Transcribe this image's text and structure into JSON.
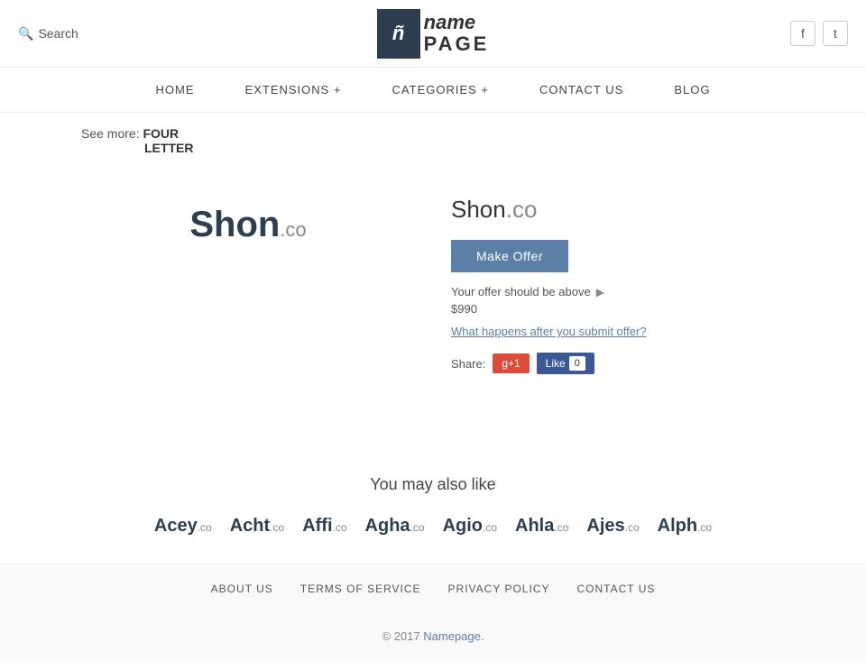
{
  "header": {
    "search_label": "Search",
    "logo_icon": "ñ",
    "logo_name": "name",
    "logo_page": "PAGE",
    "facebook_icon": "f",
    "twitter_icon": "t"
  },
  "nav": {
    "items": [
      {
        "label": "HOME",
        "id": "home"
      },
      {
        "label": "EXTENSIONS +",
        "id": "extensions"
      },
      {
        "label": "CATEGORIES +",
        "id": "categories"
      },
      {
        "label": "CONTACT US",
        "id": "contact"
      },
      {
        "label": "BLOG",
        "id": "blog"
      }
    ]
  },
  "breadcrumb": {
    "prefix": "See more:",
    "link1": "FOUR",
    "link2": "LETTER"
  },
  "domain": {
    "name": "Shon",
    "tld": ".co",
    "full": "Shon.co",
    "make_offer_label": "Make Offer",
    "offer_hint": "Your offer should be above",
    "offer_amount": "$990",
    "what_happens": "What happens after you submit offer?",
    "share_label": "Share:",
    "gplus_label": "g+1",
    "fb_like_label": "Like",
    "like_count": "0"
  },
  "also_like": {
    "title": "You may also like",
    "domains": [
      {
        "name": "Acey",
        "tld": ".co"
      },
      {
        "name": "Acht",
        "tld": ".co"
      },
      {
        "name": "Affi",
        "tld": ".co"
      },
      {
        "name": "Agha",
        "tld": ".co"
      },
      {
        "name": "Agio",
        "tld": ".co"
      },
      {
        "name": "Ahla",
        "tld": ".co"
      },
      {
        "name": "Ajes",
        "tld": ".co"
      },
      {
        "name": "Alph",
        "tld": ".co"
      }
    ]
  },
  "footer": {
    "links": [
      {
        "label": "ABOUT US",
        "id": "about"
      },
      {
        "label": "TERMS OF SERVICE",
        "id": "terms"
      },
      {
        "label": "PRIVACY POLICY",
        "id": "privacy"
      },
      {
        "label": "CONTACT US",
        "id": "contact"
      }
    ],
    "copyright": "© 2017",
    "brand": "Namepage."
  }
}
